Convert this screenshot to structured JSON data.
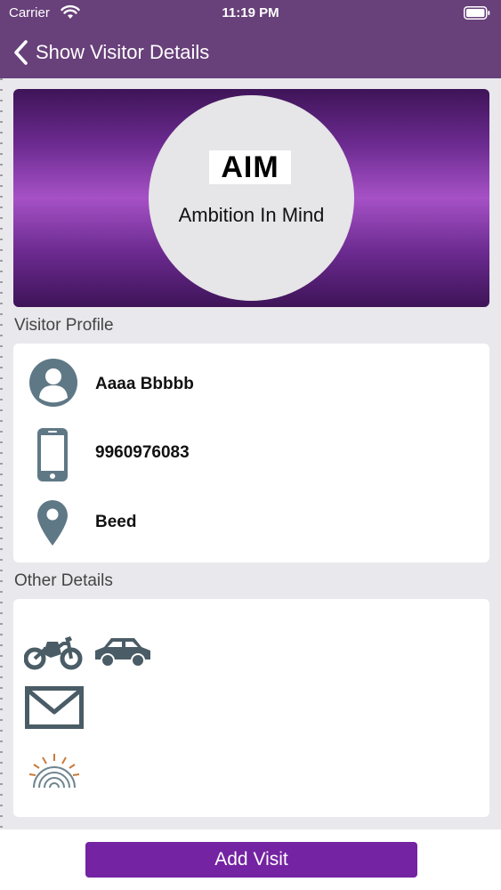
{
  "status_bar": {
    "carrier": "Carrier",
    "time": "11:19 PM",
    "wifi_icon": "wifi-icon",
    "battery_icon": "battery-icon"
  },
  "nav": {
    "back_icon": "chevron-left-icon",
    "title": "Show Visitor Details"
  },
  "banner": {
    "logo_title": "AIM",
    "logo_subtitle": "Ambition In Mind",
    "gradient_colors": [
      "#3e1458",
      "#a651c6"
    ]
  },
  "visitor_profile": {
    "heading": "Visitor Profile",
    "name": "Aaaa Bbbbb",
    "phone": "9960976083",
    "location": "Beed",
    "icons": [
      "person-icon",
      "phone-icon",
      "location-pin-icon"
    ]
  },
  "other_details": {
    "heading": "Other Details",
    "icons": [
      "motorcycle-icon",
      "car-icon",
      "mail-icon",
      "aadhaar-icon"
    ]
  },
  "actions": {
    "add_visit_label": "Add Visit"
  },
  "colors": {
    "nav_bar": "#68407a",
    "primary_button": "#7423a3",
    "icon_gray": "#5f7886"
  }
}
